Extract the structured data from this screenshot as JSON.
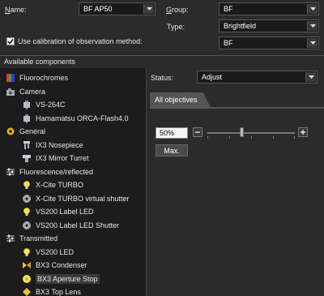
{
  "name": {
    "label_prefix": "N",
    "label_rest": "ame:",
    "value": "BF AP50"
  },
  "group": {
    "label_prefix": "G",
    "label_rest": "roup:",
    "value": "BF"
  },
  "type": {
    "label": "Type:",
    "value": "Brightfield"
  },
  "calibration": {
    "checked": true,
    "label": "Use calibration of observation method:",
    "value": "BF"
  },
  "available_header": "Available components",
  "status": {
    "label": "Status:",
    "value": "Adjust"
  },
  "tab_label": "All objectives",
  "position": {
    "value": "50",
    "unit": "%"
  },
  "max_button": "Max.",
  "tree": [
    {
      "label": "Fluorochromes",
      "icon": "fluorochromes-icon",
      "indent": 0
    },
    {
      "label": "Camera",
      "icon": "camera-icon",
      "indent": 0
    },
    {
      "label": "VS-264C",
      "icon": "camera-device-icon",
      "indent": 1
    },
    {
      "label": "Hamamatsu ORCA-Flash4.0",
      "icon": "camera-device-icon",
      "indent": 1
    },
    {
      "label": "General",
      "icon": "general-icon",
      "indent": 0
    },
    {
      "label": "IX3 Nosepiece",
      "icon": "nosepiece-icon",
      "indent": 1
    },
    {
      "label": "IX3 Mirror Turret",
      "icon": "turret-icon",
      "indent": 1
    },
    {
      "label": "Fluorescence/reflected",
      "icon": "sliders-icon",
      "indent": 0
    },
    {
      "label": "X-Cite TURBO",
      "icon": "lamp-icon",
      "indent": 1
    },
    {
      "label": "X-Cite TURBO virtual shutter",
      "icon": "shutter-icon",
      "indent": 1
    },
    {
      "label": "VS200 Label LED",
      "icon": "lamp-icon",
      "indent": 1
    },
    {
      "label": "VS200 Label LED Shutter",
      "icon": "shutter-icon",
      "indent": 1
    },
    {
      "label": "Transmitted",
      "icon": "sliders-icon",
      "indent": 0
    },
    {
      "label": "VS200 LED",
      "icon": "lamp-icon",
      "indent": 1
    },
    {
      "label": "BX3 Condenser",
      "icon": "condenser-icon",
      "indent": 1
    },
    {
      "label": "BX3 Aperture Stop",
      "icon": "aperture-icon",
      "indent": 1,
      "selected": true
    },
    {
      "label": "BX3 Top Lens",
      "icon": "lens-icon",
      "indent": 1
    }
  ]
}
